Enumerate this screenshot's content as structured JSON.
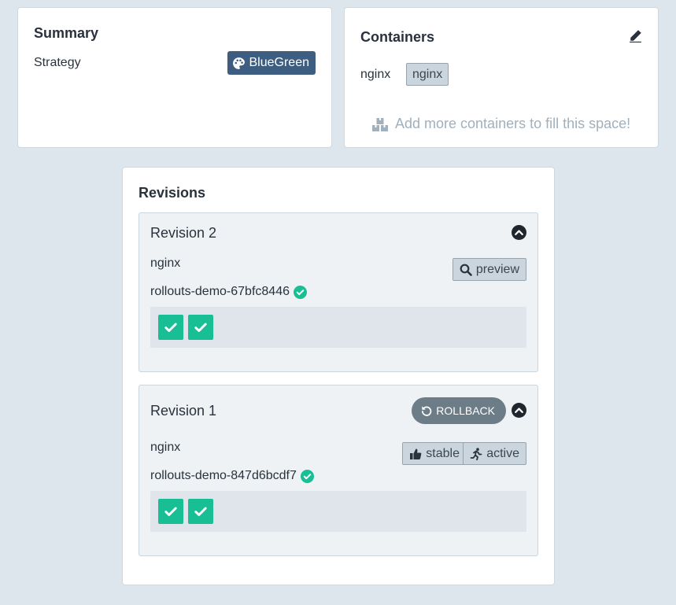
{
  "summary": {
    "title": "Summary",
    "strategy_label": "Strategy",
    "strategy_value": "BlueGreen",
    "strategy_icon": "palette-icon",
    "badge_color": "#3d5e81"
  },
  "containers": {
    "title": "Containers",
    "edit_icon": "pencil-icon",
    "items": [
      {
        "name": "nginx",
        "image": "nginx"
      }
    ],
    "add_more_text": "Add more containers to fill this space!",
    "add_more_icon": "boxes-icon"
  },
  "revisions": {
    "title": "Revisions",
    "items": [
      {
        "title": "Revision 2",
        "container": "nginx",
        "replicaset": "rollouts-demo-67bfc8446",
        "status_icon": "check-circle-icon",
        "tags": [
          {
            "label": "preview",
            "icon": "search-icon"
          }
        ],
        "pods": [
          "healthy",
          "healthy"
        ],
        "collapse_icon": "chevron-up-circle-icon"
      },
      {
        "title": "Revision 1",
        "rollback_label": "ROLLBACK",
        "container": "nginx",
        "replicaset": "rollouts-demo-847d6bcdf7",
        "status_icon": "check-circle-icon",
        "tags": [
          {
            "label": "stable",
            "icon": "thumbs-up-icon"
          },
          {
            "label": "active",
            "icon": "running-icon"
          }
        ],
        "pods": [
          "healthy",
          "healthy"
        ],
        "collapse_icon": "chevron-up-circle-icon"
      }
    ]
  },
  "colors": {
    "background": "#dee6ed",
    "pod_healthy": "#18be94",
    "rollback_button": "#6d7d88"
  }
}
